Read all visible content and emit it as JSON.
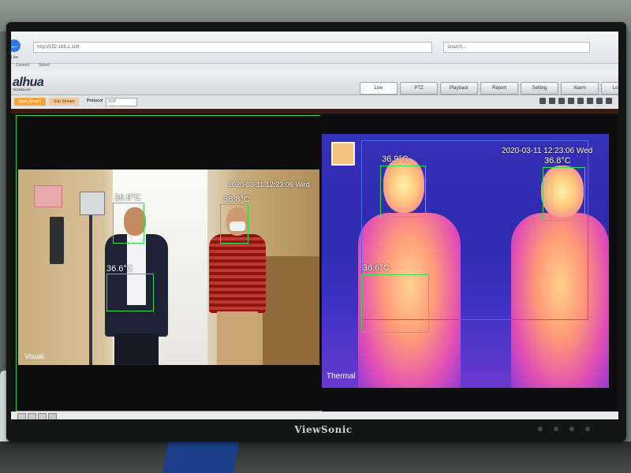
{
  "monitor": {
    "brand": "ViewSonic"
  },
  "browser": {
    "url": "http://192.168.1.108",
    "search_placeholder": "Search...",
    "tab": "Live",
    "favorites": [
      "Convert",
      "Select"
    ]
  },
  "app": {
    "logo": "alhua",
    "logo_sub": "TECHNOLOGY",
    "nav": [
      {
        "label": "Live",
        "active": true
      },
      {
        "label": "PTZ"
      },
      {
        "label": "Playback"
      },
      {
        "label": "Report"
      },
      {
        "label": "Setting"
      },
      {
        "label": "Alarm"
      },
      {
        "label": "Logout"
      }
    ],
    "toolbar": {
      "main_stream": "Main Stream",
      "sub_stream": "Sub Stream",
      "protocol_label": "Protocol",
      "protocol_value": "TCP"
    }
  },
  "visual": {
    "label": "Visual",
    "timestamp": "2020-03-11 12:23:06 Wed",
    "temps": [
      "36.9°C",
      "36.8°C",
      "36.6°C"
    ]
  },
  "thermal": {
    "label": "Thermal",
    "timestamp": "2020-03-11 12:23:06 Wed",
    "temps": [
      "36.9°C",
      "36.8°C",
      "36.6°C"
    ]
  },
  "colors": {
    "detection_box": "#2fe04c",
    "main_stream_btn": "#f7a23a",
    "thermal_bg": "#3730b8"
  }
}
